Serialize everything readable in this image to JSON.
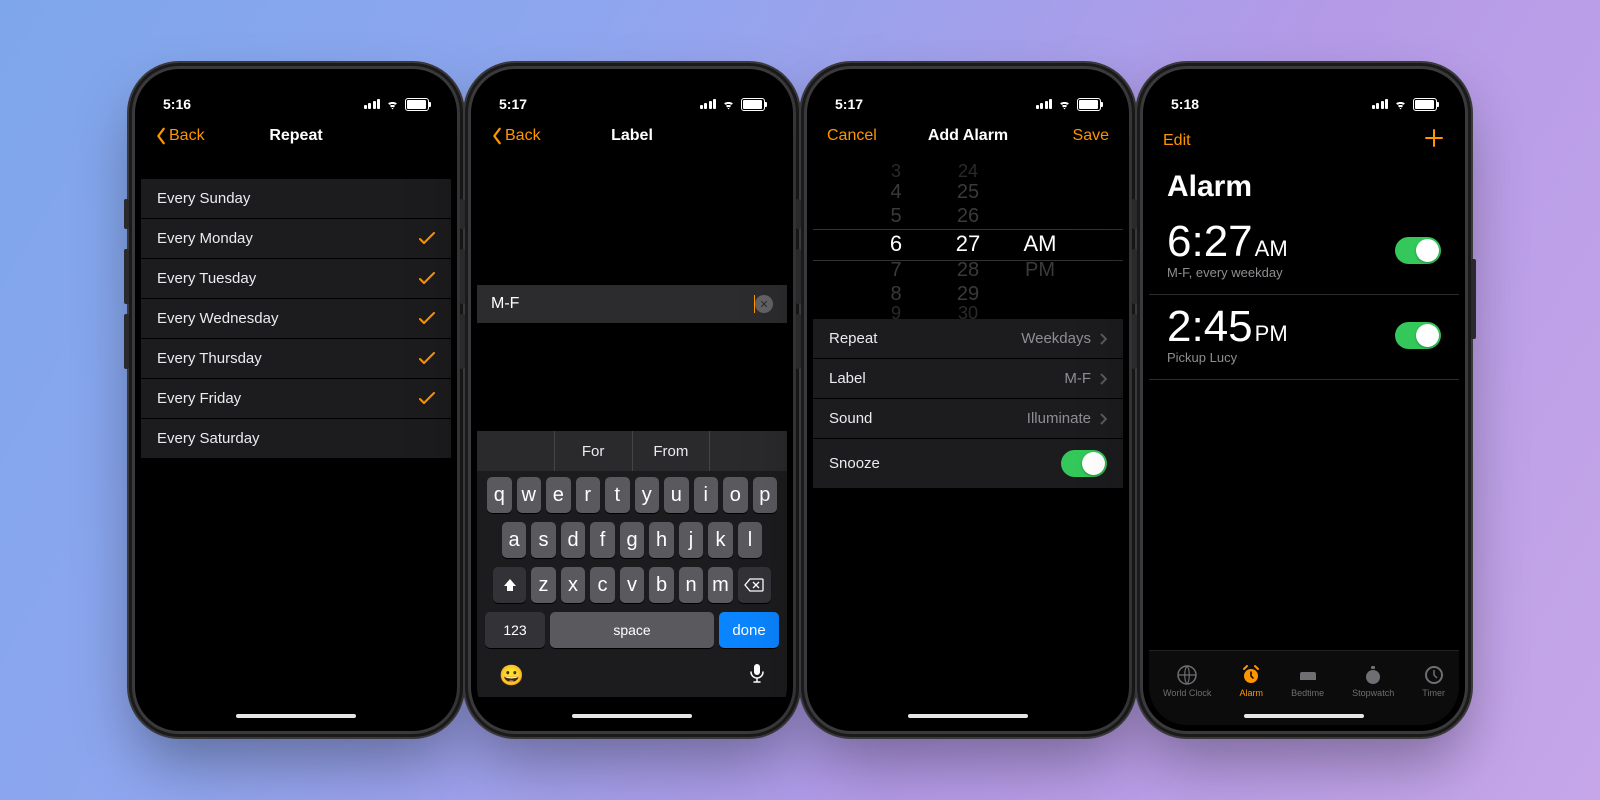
{
  "phone1": {
    "time": "5:16",
    "back": "Back",
    "title": "Repeat",
    "days": [
      {
        "label": "Every Sunday",
        "checked": false
      },
      {
        "label": "Every Monday",
        "checked": true
      },
      {
        "label": "Every Tuesday",
        "checked": true
      },
      {
        "label": "Every Wednesday",
        "checked": true
      },
      {
        "label": "Every Thursday",
        "checked": true
      },
      {
        "label": "Every Friday",
        "checked": true
      },
      {
        "label": "Every Saturday",
        "checked": false
      }
    ]
  },
  "phone2": {
    "time": "5:17",
    "back": "Back",
    "title": "Label",
    "input": "M-F",
    "predict": [
      "",
      "For",
      "From",
      ""
    ],
    "kb": {
      "row1": [
        "q",
        "w",
        "e",
        "r",
        "t",
        "y",
        "u",
        "i",
        "o",
        "p"
      ],
      "row2": [
        "a",
        "s",
        "d",
        "f",
        "g",
        "h",
        "j",
        "k",
        "l"
      ],
      "row3": [
        "z",
        "x",
        "c",
        "v",
        "b",
        "n",
        "m"
      ],
      "num": "123",
      "space": "space",
      "done": "done"
    }
  },
  "phone3": {
    "time": "5:17",
    "cancel": "Cancel",
    "title": "Add Alarm",
    "save": "Save",
    "picker": {
      "hours": [
        "3",
        "4",
        "5",
        "6",
        "7",
        "8",
        "9"
      ],
      "mins": [
        "24",
        "25",
        "26",
        "27",
        "28",
        "29",
        "30"
      ],
      "ampm": [
        "AM",
        "PM"
      ]
    },
    "rows": [
      {
        "label": "Repeat",
        "value": "Weekdays"
      },
      {
        "label": "Label",
        "value": "M-F"
      },
      {
        "label": "Sound",
        "value": "Illuminate"
      }
    ],
    "snooze": "Snooze"
  },
  "phone4": {
    "time": "5:18",
    "edit": "Edit",
    "heading": "Alarm",
    "alarms": [
      {
        "time": "6:27",
        "ampm": "AM",
        "sub": "M-F, every weekday"
      },
      {
        "time": "2:45",
        "ampm": "PM",
        "sub": "Pickup Lucy"
      }
    ],
    "tabs": [
      "World Clock",
      "Alarm",
      "Bedtime",
      "Stopwatch",
      "Timer"
    ]
  }
}
